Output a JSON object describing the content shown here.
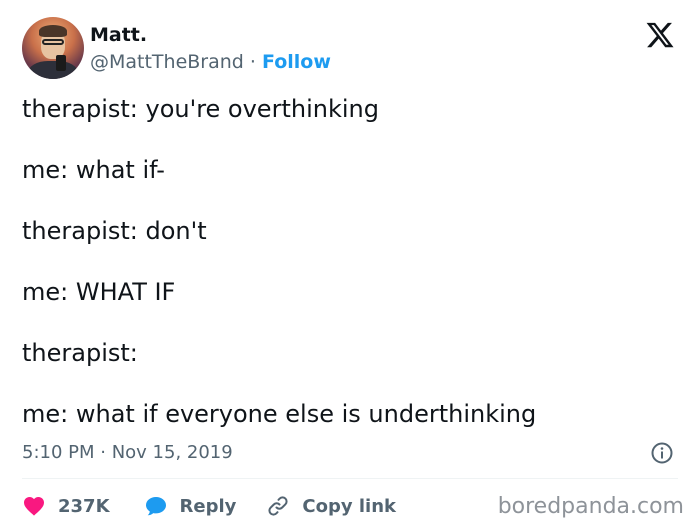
{
  "author": {
    "name": "Matt.",
    "handle": "@MattTheBrand",
    "separator": "·",
    "follow_label": "Follow"
  },
  "tweet": {
    "lines": [
      "therapist: you're overthinking",
      "me: what if-",
      "therapist: don't",
      "me: WHAT IF",
      "therapist:",
      "me: what if everyone else is underthinking"
    ],
    "timestamp": "5:10 PM · Nov 15, 2019"
  },
  "actions": {
    "likes_count": "237K",
    "reply_label": "Reply",
    "copy_link_label": "Copy link"
  },
  "watermark": "boredpanda.com",
  "colors": {
    "like": "#f91880",
    "reply": "#1d9bf0",
    "follow": "#1d9bf0",
    "secondary_text": "#536471"
  },
  "icons": {
    "logo": "x-logo-icon",
    "info": "info-icon",
    "like": "heart-icon",
    "reply": "speech-bubble-icon",
    "copy": "link-icon"
  }
}
